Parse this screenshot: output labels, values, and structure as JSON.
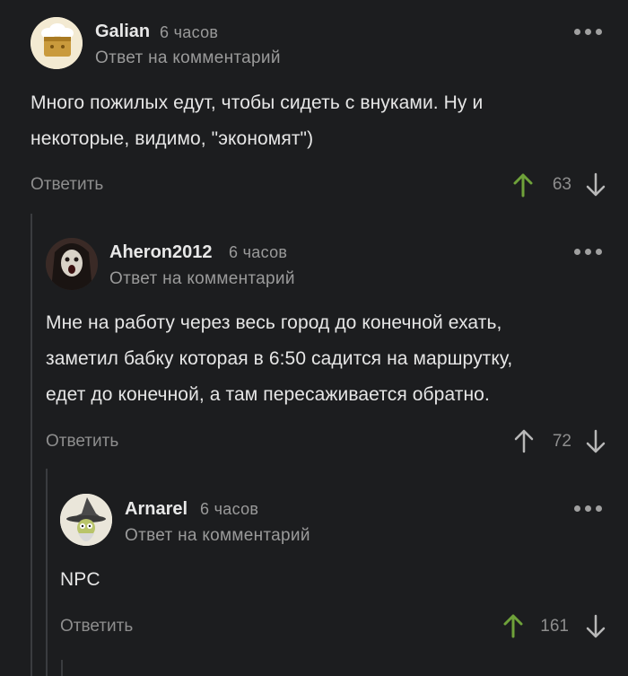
{
  "colors": {
    "background": "#1c1d1f",
    "upvote_active": "#6fa23a",
    "upvote_neutral": "#b8b8b8",
    "thread_line": "#3a3c3f"
  },
  "comments": [
    {
      "author": "Galian",
      "time": "6 часов",
      "reply_note": "Ответ на комментарий",
      "text_lines": [
        "Много пожилых едут, чтобы сидеть с внуками. Ну и",
        "некоторые, видимо, \"экономят\")"
      ],
      "reply_label": "Ответить",
      "score": "63",
      "upvoted": true,
      "avatar_icon": "chef-hat-avatar-icon"
    },
    {
      "author": "Aheron2012",
      "time": "6 часов",
      "reply_note": "Ответ на комментарий",
      "text_lines": [
        "Мне на работу через весь город до конечной ехать,",
        "заметил бабку которая в 6:50 садится на маршрутку,",
        "едет до конечной, а там пересаживается обратно."
      ],
      "reply_label": "Ответить",
      "score": "72",
      "upvoted": false,
      "avatar_icon": "screaming-face-avatar-icon"
    },
    {
      "author": "Arnarel",
      "time": "6 часов",
      "reply_note": "Ответ на комментарий",
      "text_lines": [
        "NPC"
      ],
      "reply_label": "Ответить",
      "score": "161",
      "upvoted": true,
      "avatar_icon": "wizard-avatar-icon"
    }
  ]
}
